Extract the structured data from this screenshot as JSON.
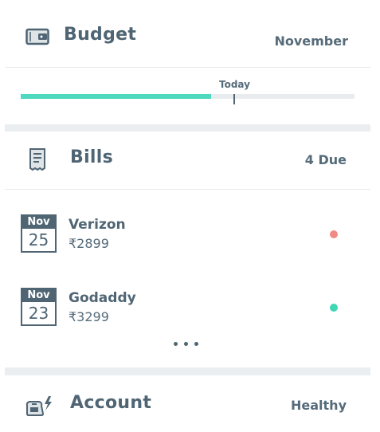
{
  "budget": {
    "title": "Budget",
    "month": "November",
    "today_label": "Today",
    "progress": 0.57,
    "today_position": 0.64,
    "icon": "wallet-icon"
  },
  "bills": {
    "title": "Bills",
    "due": "4 Due",
    "icon": "receipt-icon",
    "items": [
      {
        "month": "Nov",
        "day": "25",
        "name": "Verizon",
        "amount": "₹2899",
        "status_color": "#f08a84"
      },
      {
        "month": "Nov",
        "day": "23",
        "name": "Godaddy",
        "amount": "₹3299",
        "status_color": "#3fd6b4"
      }
    ]
  },
  "account": {
    "title": "Account",
    "status": "Healthy",
    "icon": "fax-icon"
  },
  "colors": {
    "accent": "#4fd9bf",
    "text": "#4f6574",
    "track": "#e8ecee"
  }
}
